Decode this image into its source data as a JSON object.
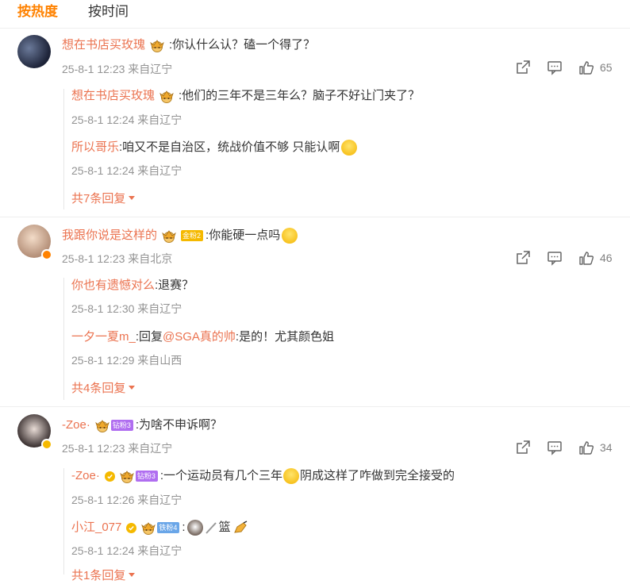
{
  "tabs": {
    "hot": "按热度",
    "time": "按时间"
  },
  "comments": [
    {
      "user": "想在书店买玫瑰",
      "text": ":你认什么认？磕一个得了？",
      "meta": "25-8-1 12:23 来自辽宁",
      "likes": "65",
      "replies": [
        {
          "user": "想在书店买玫瑰",
          "text": ":他们的三年不是三年么？脑子不好让门夹了？",
          "meta": "25-8-1 12:24 来自辽宁"
        },
        {
          "user": "所以哥乐",
          "text": ":咱又不是自治区，统战价值不够 只能认啊",
          "meta": "25-8-1 12:24 来自辽宁"
        }
      ],
      "more": "共7条回复"
    },
    {
      "user": "我跟你说是这样的",
      "badge": "金粉2",
      "text": ":你能硬一点吗",
      "meta": "25-8-1 12:23 来自北京",
      "likes": "46",
      "replies": [
        {
          "user": "你也有遗憾对么",
          "text": ":退赛？",
          "meta": "25-8-1 12:30 来自辽宁"
        },
        {
          "user": "一夕一夏m_",
          "text_pre": ":回复",
          "mention": "@SGA真的帅",
          "text": ":是的！尤其颜色姐",
          "meta": "25-8-1 12:29 来自山西"
        }
      ],
      "more": "共4条回复"
    },
    {
      "user": "-Zoe·",
      "badge": "钻粉3",
      "text": ":为啥不申诉啊？",
      "meta": "25-8-1 12:23 来自辽宁",
      "likes": "34",
      "replies": [
        {
          "user": "-Zoe·",
          "badge": "钻粉3",
          "text_pre": ":一个运动员有几个三年",
          "text": "阴成这样了咋做到完全接受的",
          "meta": "25-8-1 12:26 来自辽宁"
        },
        {
          "user": "小江_077",
          "badge": "铁粉4",
          "text_pre": ":",
          "text": "篮",
          "meta": "25-8-1 12:24 来自辽宁"
        }
      ],
      "more": "共1条回复"
    }
  ],
  "colors": {
    "accent": "#ff8200",
    "username": "#eb7350",
    "meta": "#939393",
    "gold": "#f5b900",
    "diamond": "#b06ef0",
    "iron": "#6aa6e8"
  },
  "icons": [
    "share-icon",
    "comment-icon",
    "like-icon",
    "crown-icon",
    "verified-icon"
  ]
}
